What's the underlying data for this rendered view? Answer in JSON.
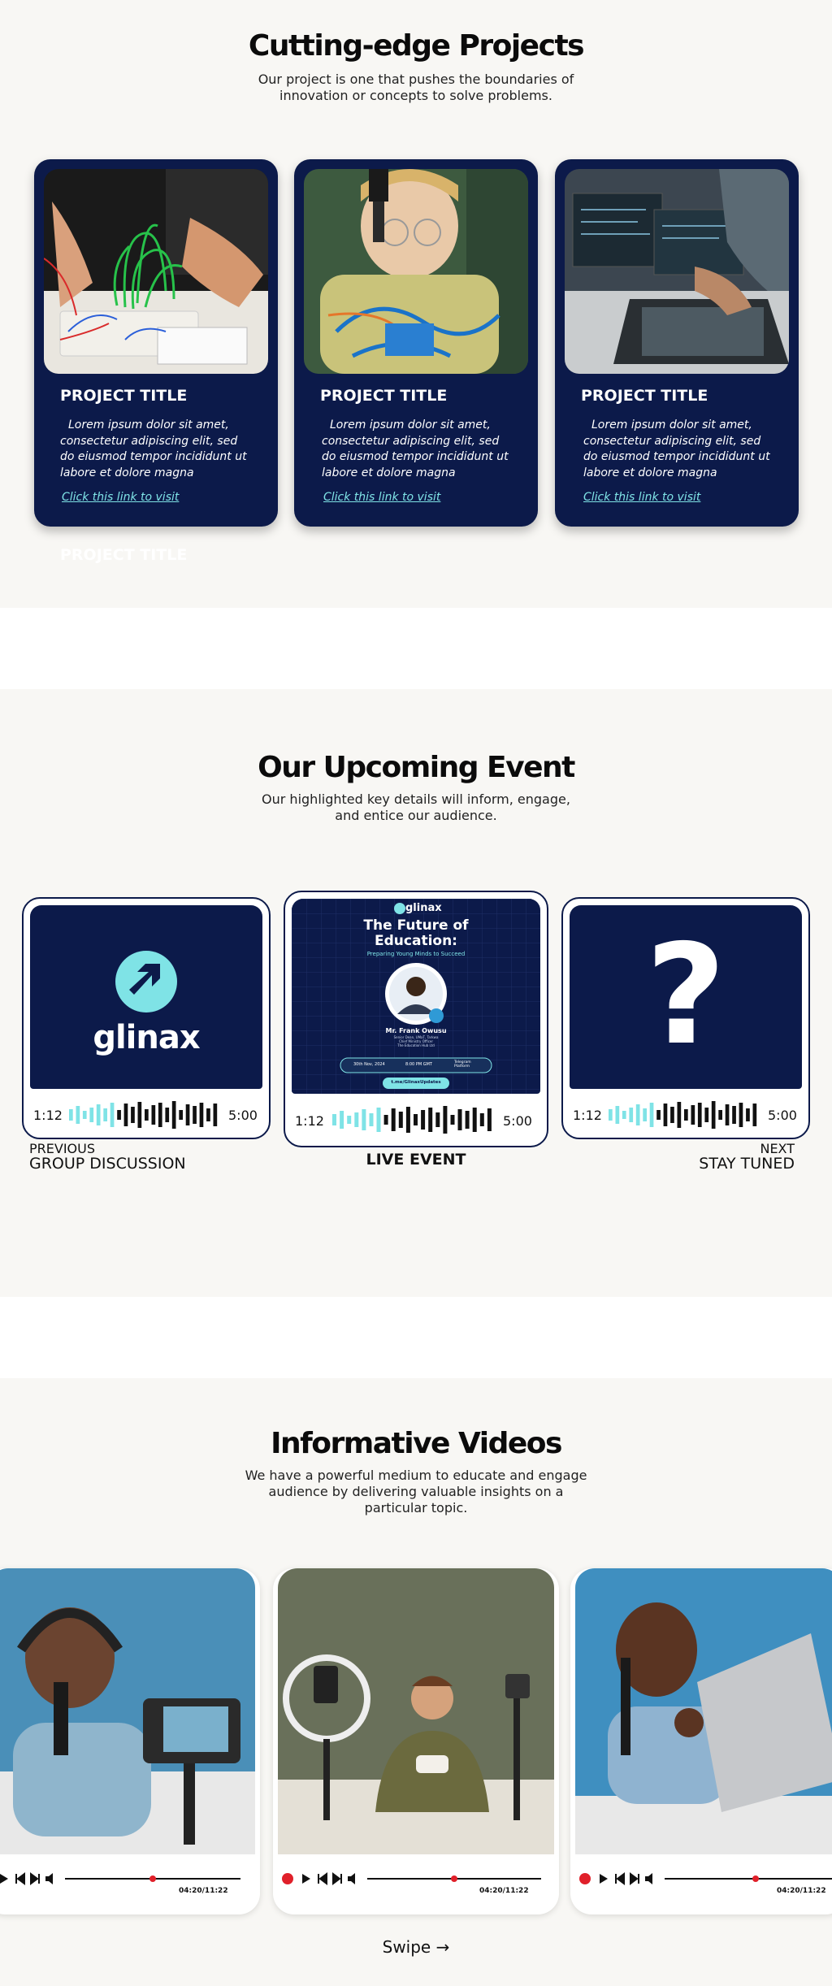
{
  "projects": {
    "title": "Cutting-edge Projects",
    "subtitle": "Our project is one that pushes the boundaries of innovation or concepts to solve problems.",
    "cards": [
      {
        "title": "PROJECT TITLE",
        "desc": "Lorem ipsum dolor sit amet, consectetur adipiscing elit, sed do eiusmod tempor incididunt ut labore et dolore magna",
        "link": "Click this link to visit",
        "image": "electronics-breadboard-wiring"
      },
      {
        "title": "PROJECT TITLE",
        "desc": "Lorem ipsum dolor sit amet, consectetur adipiscing elit, sed do eiusmod tempor incididunt ut labore et dolore magna",
        "link": "Click this link to visit",
        "image": "child-soldering-circuit"
      },
      {
        "title": "PROJECT TITLE",
        "desc": "Lorem ipsum dolor sit amet, consectetur adipiscing elit, sed do eiusmod tempor incididunt ut labore et dolore magna",
        "link": "Click this link to visit",
        "image": "hands-laptop-monitors"
      }
    ]
  },
  "events": {
    "title": "Our Upcoming Event",
    "subtitle": "Our highlighted key details will inform, engage, and entice our audience.",
    "cards": [
      {
        "brand": "glinax",
        "time_start": "1:12",
        "time_end": "5:00"
      },
      {
        "brand": "glinax",
        "headline_1": "The Future of",
        "headline_2": "Education:",
        "tagline": "Preparing Young Minds to Succeed",
        "speaker": "Mr. Frank Owusu",
        "speaker_role_1": "Senior Dean, UMaT, Tarkwa",
        "speaker_role_2": "Chief Ministry Officer",
        "speaker_role_3": "The Education Hub Ltd",
        "date": "30th Nov, 2024",
        "time": "8:00 PM GMT",
        "platform": "Telegram Platform",
        "handle": "t.me/GlinaxUpdates",
        "time_start": "1:12",
        "time_end": "5:00"
      },
      {
        "symbol": "?",
        "time_start": "1:12",
        "time_end": "5:00"
      }
    ],
    "prev_small": "PREVIOUS",
    "prev_big": "GROUP DISCUSSION",
    "live_label": "LIVE EVENT",
    "next_small": "NEXT",
    "next_big": "STAY TUNED"
  },
  "videos": {
    "title": "Informative Videos",
    "subtitle": "We have a powerful medium to educate and engage audience by delivering valuable insights on a particular topic.",
    "cards": [
      {
        "image": "man-headphones-podcast",
        "timecode": "04:20/11:22",
        "progress": 0.5
      },
      {
        "image": "man-ring-light-kitchen",
        "timecode": "04:20/11:22",
        "progress": 0.5
      },
      {
        "image": "man-laptop-microphone",
        "timecode": "04:20/11:22",
        "progress": 0.5
      }
    ],
    "swipe": "Swipe →"
  },
  "colors": {
    "navy": "#0c1a4a",
    "accent": "#7fe3e6",
    "record_red": "#e0202a",
    "bg": "#f8f7f4"
  }
}
